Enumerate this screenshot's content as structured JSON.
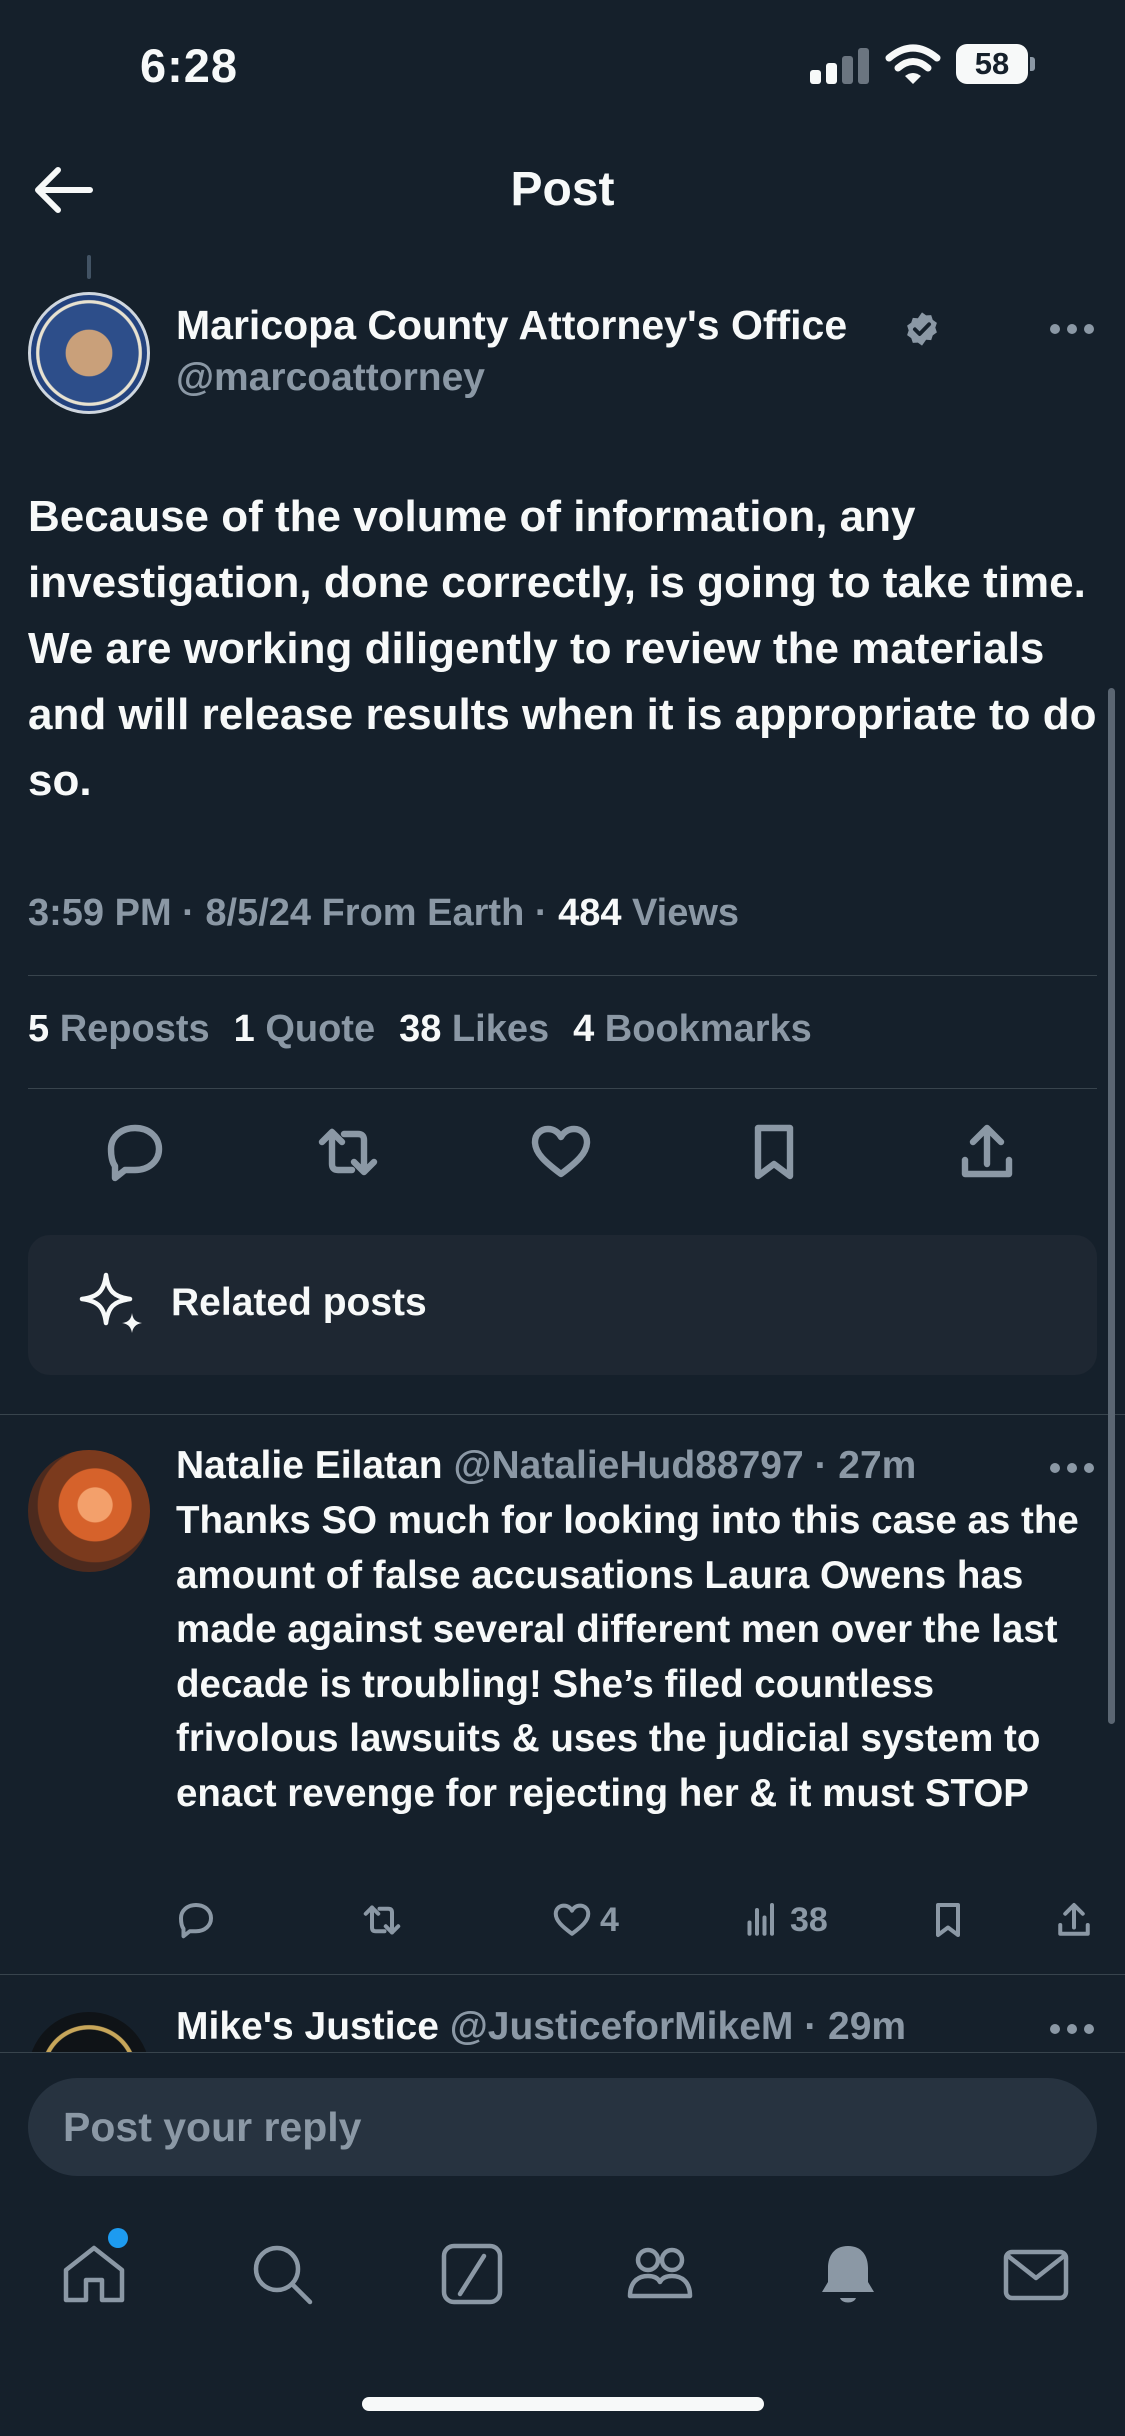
{
  "status_bar": {
    "time": "6:28",
    "battery": "58"
  },
  "header": {
    "title": "Post"
  },
  "post": {
    "author_name": "Maricopa County Attorney's Office",
    "author_handle": "@marcoattorney",
    "text": "Because of the volume of information, any investigation, done correctly, is going to take time.  We are working diligently to review the materials and will release results when it is appropriate to do so.",
    "timestamp": "3:59 PM · 8/5/24 From Earth · ",
    "views_count": "484",
    "views_label": " Views",
    "stats": {
      "reposts_count": "5",
      "reposts_label": " Reposts",
      "quotes_count": "1",
      "quotes_label": " Quote",
      "likes_count": "38",
      "likes_label": " Likes",
      "bookmarks_count": "4",
      "bookmarks_label": " Bookmarks"
    }
  },
  "related": {
    "label": "Related posts"
  },
  "replies": [
    {
      "name": "Natalie Eilatan",
      "handle": "@NatalieHud88797 · 27m",
      "text": "Thanks SO much for looking into this case as the amount of false accusations Laura Owens has made against several different men over the last decade is troubling! She’s filed countless frivolous lawsuits & uses the judicial system to enact revenge for rejecting her & it must STOP",
      "likes": "4",
      "views": "38"
    },
    {
      "name": "Mike's Justice",
      "handle": "@JusticeforMikeM · 29m"
    }
  ],
  "reply_box": {
    "placeholder": "Post your reply"
  },
  "icons": {
    "back": "arrow-left-icon",
    "verified": "verified-badge-icon",
    "more": "more-dots-icon",
    "reply": "reply-icon",
    "repost": "repost-icon",
    "like": "heart-icon",
    "bookmark": "bookmark-icon",
    "share": "share-icon",
    "views": "views-chart-icon",
    "related": "sparkle-icon",
    "tabs": [
      "home-icon",
      "search-icon",
      "grok-icon",
      "communities-icon",
      "notifications-icon",
      "messages-icon"
    ]
  },
  "colors": {
    "background": "#15202b",
    "accent": "#1d9bf0",
    "muted": "#8b98a5",
    "text": "#f7f9f9"
  }
}
